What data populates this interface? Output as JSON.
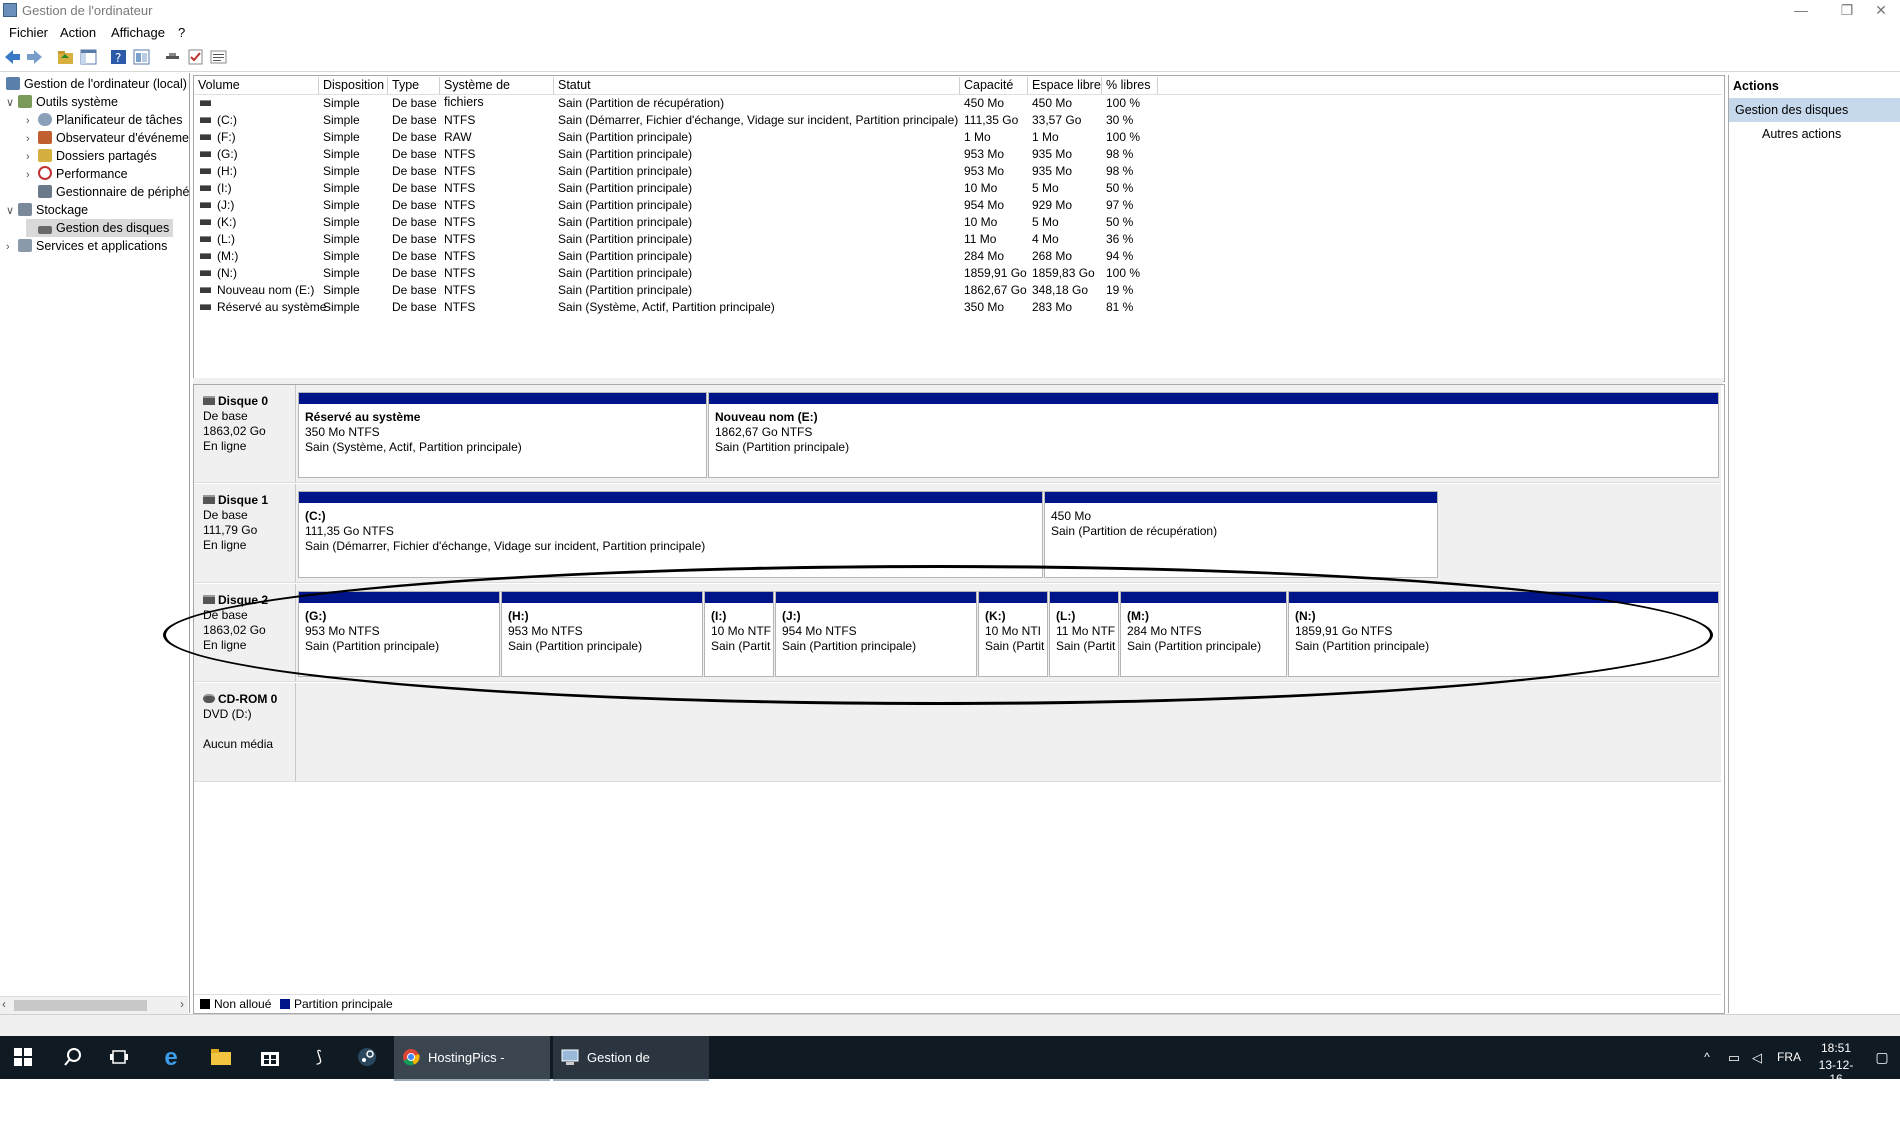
{
  "window": {
    "title": "Gestion de l'ordinateur",
    "minimize": "—",
    "restore": "❐",
    "close": "✕"
  },
  "menu": [
    "Fichier",
    "Action",
    "Affichage",
    "?"
  ],
  "tree": [
    {
      "label": "Gestion de l'ordinateur (local)",
      "twisty": "",
      "depth": 0,
      "color": "#5a7fa8"
    },
    {
      "label": "Outils système",
      "twisty": "∨",
      "depth": 1,
      "color": "#7a9a5a"
    },
    {
      "label": "Planificateur de tâches",
      "twisty": "›",
      "depth": 2,
      "color": "#8aa0b8"
    },
    {
      "label": "Observateur d'événeme",
      "twisty": "›",
      "depth": 2,
      "color": "#c06030"
    },
    {
      "label": "Dossiers partagés",
      "twisty": "›",
      "depth": 2,
      "color": "#d4b040"
    },
    {
      "label": "Performance",
      "twisty": "›",
      "depth": 2,
      "color": "#c03030"
    },
    {
      "label": "Gestionnaire de périphé",
      "twisty": "",
      "depth": 2,
      "color": "#6a7a8a"
    },
    {
      "label": "Stockage",
      "twisty": "∨",
      "depth": 1,
      "color": "#7a8a9a"
    },
    {
      "label": "Gestion des disques",
      "twisty": "",
      "depth": 2,
      "color": "#6a6a6a",
      "selected": true
    },
    {
      "label": "Services et applications",
      "twisty": "›",
      "depth": 1,
      "color": "#8a9aaa"
    }
  ],
  "volume_table": {
    "headers": [
      "Volume",
      "Disposition",
      "Type",
      "Système de fichiers",
      "Statut",
      "Capacité",
      "Espace libre",
      "% libres"
    ],
    "rows": [
      [
        "",
        "Simple",
        "De base",
        "",
        "Sain (Partition de récupération)",
        "450 Mo",
        "450 Mo",
        "100 %"
      ],
      [
        "(C:)",
        "Simple",
        "De base",
        "NTFS",
        "Sain (Démarrer, Fichier d'échange, Vidage sur incident, Partition principale)",
        "111,35 Go",
        "33,57 Go",
        "30 %"
      ],
      [
        "(F:)",
        "Simple",
        "De base",
        "RAW",
        "Sain (Partition principale)",
        "1 Mo",
        "1 Mo",
        "100 %"
      ],
      [
        "(G:)",
        "Simple",
        "De base",
        "NTFS",
        "Sain (Partition principale)",
        "953 Mo",
        "935 Mo",
        "98 %"
      ],
      [
        "(H:)",
        "Simple",
        "De base",
        "NTFS",
        "Sain (Partition principale)",
        "953 Mo",
        "935 Mo",
        "98 %"
      ],
      [
        "(I:)",
        "Simple",
        "De base",
        "NTFS",
        "Sain (Partition principale)",
        "10 Mo",
        "5 Mo",
        "50 %"
      ],
      [
        "(J:)",
        "Simple",
        "De base",
        "NTFS",
        "Sain (Partition principale)",
        "954 Mo",
        "929 Mo",
        "97 %"
      ],
      [
        "(K:)",
        "Simple",
        "De base",
        "NTFS",
        "Sain (Partition principale)",
        "10 Mo",
        "5 Mo",
        "50 %"
      ],
      [
        "(L:)",
        "Simple",
        "De base",
        "NTFS",
        "Sain (Partition principale)",
        "11 Mo",
        "4 Mo",
        "36 %"
      ],
      [
        "(M:)",
        "Simple",
        "De base",
        "NTFS",
        "Sain (Partition principale)",
        "284 Mo",
        "268 Mo",
        "94 %"
      ],
      [
        "(N:)",
        "Simple",
        "De base",
        "NTFS",
        "Sain (Partition principale)",
        "1859,91 Go",
        "1859,83 Go",
        "100 %"
      ],
      [
        "Nouveau nom (E:)",
        "Simple",
        "De base",
        "NTFS",
        "Sain (Partition principale)",
        "1862,67 Go",
        "348,18 Go",
        "19 %"
      ],
      [
        "Réservé au système",
        "Simple",
        "De base",
        "NTFS",
        "Sain (Système, Actif, Partition principale)",
        "350 Mo",
        "283 Mo",
        "81 %"
      ]
    ]
  },
  "disks": [
    {
      "name": "Disque 0",
      "type": "De base",
      "size": "1863,02 Go",
      "status": "En ligne",
      "partitions": [
        {
          "name": "Réservé au système",
          "size": "350 Mo NTFS",
          "status": "Sain (Système, Actif, Partition principale)"
        },
        {
          "name": "Nouveau nom  (E:)",
          "size": "1862,67 Go NTFS",
          "status": "Sain (Partition principale)"
        }
      ]
    },
    {
      "name": "Disque 1",
      "type": "De base",
      "size": "111,79 Go",
      "status": "En ligne",
      "partitions": [
        {
          "name": "(C:)",
          "size": "111,35 Go NTFS",
          "status": "Sain (Démarrer, Fichier d'échange, Vidage sur incident, Partition principale)"
        },
        {
          "name": "",
          "size": "450 Mo",
          "status": "Sain (Partition de récupération)"
        }
      ]
    },
    {
      "name": "Disque 2",
      "type": "De base",
      "size": "1863,02 Go",
      "status": "En ligne",
      "partitions": [
        {
          "name": "(G:)",
          "size": "953 Mo NTFS",
          "status": "Sain (Partition principale)"
        },
        {
          "name": "(H:)",
          "size": "953 Mo NTFS",
          "status": "Sain (Partition principale)"
        },
        {
          "name": "(I:)",
          "size": "10 Mo NTF",
          "status": "Sain (Partit"
        },
        {
          "name": "(J:)",
          "size": "954 Mo NTFS",
          "status": "Sain (Partition principale)"
        },
        {
          "name": "(K:)",
          "size": "10 Mo NTI",
          "status": "Sain (Partit"
        },
        {
          "name": "(L:)",
          "size": "11 Mo NTF",
          "status": "Sain (Partit"
        },
        {
          "name": "(M:)",
          "size": "284 Mo NTFS",
          "status": "Sain (Partition principale)"
        },
        {
          "name": "(N:)",
          "size": "1859,91 Go NTFS",
          "status": "Sain (Partition principale)"
        }
      ]
    },
    {
      "name": "CD-ROM 0",
      "type": "DVD (D:)",
      "size": "",
      "status": "Aucun média",
      "partitions": []
    }
  ],
  "legend": [
    {
      "label": "Non alloué",
      "color": "#000000"
    },
    {
      "label": "Partition principale",
      "color": "#001489"
    }
  ],
  "actions": {
    "title": "Actions",
    "selected": "Gestion des disques",
    "other": "Autres actions"
  },
  "taskbar": {
    "apps": [
      {
        "label": "HostingPics - Hebe...",
        "icon": "chrome-icon"
      },
      {
        "label": "Gestion de l'ordinat...",
        "icon": "computer-management-icon"
      }
    ],
    "lang": "FRA",
    "time": "18:51",
    "date": "13-12-16"
  },
  "colors": {
    "partition_bar": "#001489",
    "selection": "#c6d8ec",
    "taskbar": "#101a22"
  }
}
